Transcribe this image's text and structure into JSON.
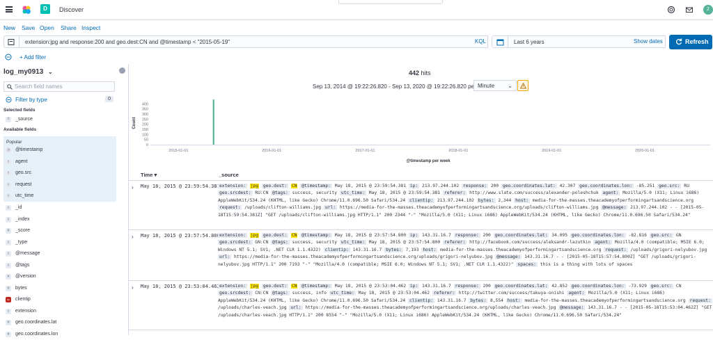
{
  "header": {
    "app_title": "Discover",
    "space_initial": "D",
    "user_initial": "2"
  },
  "menu": {
    "new": "New",
    "save": "Save",
    "open": "Open",
    "share": "Share",
    "inspect": "Inspect"
  },
  "query": {
    "text": "extension:jpg and response:200 and  geo.dest:CN and  @timestamp < \"2015-05-19\"",
    "language": "KQL"
  },
  "time": {
    "label": "Last 6 years",
    "show_dates": "Show dates",
    "refresh": "Refresh"
  },
  "filter": {
    "add": "+ Add filter"
  },
  "sidebar": {
    "index_pattern": "log_my0913",
    "search_placeholder": "Search field names",
    "filter_by_type": "Filter by type",
    "filter_count": "0",
    "selected_label": "Selected fields",
    "selected": [
      {
        "type": "?",
        "name": "_source"
      }
    ],
    "available_label": "Available fields",
    "popular_label": "Popular",
    "popular": [
      {
        "type": "◷",
        "name": "@timestamp"
      },
      {
        "type": "t",
        "name": "agent"
      },
      {
        "type": "t",
        "name": "geo.src"
      },
      {
        "type": "t",
        "name": "request"
      },
      {
        "type": "t",
        "name": "utc_time"
      }
    ],
    "fields": [
      {
        "type": "t",
        "name": "_id"
      },
      {
        "type": "t",
        "name": "_index"
      },
      {
        "type": "#",
        "name": "_score"
      },
      {
        "type": "t",
        "name": "_type"
      },
      {
        "type": "t",
        "name": "@message"
      },
      {
        "type": "t",
        "name": "@tags"
      },
      {
        "type": "#",
        "name": "@version"
      },
      {
        "type": "#",
        "name": "bytes"
      },
      {
        "type": "ip",
        "name": "clientip"
      },
      {
        "type": "t",
        "name": "extension"
      },
      {
        "type": "#",
        "name": "geo.coordinates.lat"
      },
      {
        "type": "#",
        "name": "geo.coordinates.lon"
      }
    ]
  },
  "main": {
    "hits_count": "442",
    "hits_label": "hits",
    "range_text": "Sep 13, 2014 @ 19:22:26.820 - Sep 13, 2020 @ 19:22:26.820 per",
    "interval": "Minute",
    "col_time": "Time ▾",
    "col_source": "_source"
  },
  "chart_data": {
    "type": "bar",
    "ylabel": "Count",
    "xlabel": "@timestamp per week",
    "ylim": [
      0,
      450
    ],
    "yticks": [
      "400",
      "350",
      "300",
      "250",
      "200",
      "150",
      "100",
      "50",
      "0"
    ],
    "xticks": [
      "2015-01-01",
      "2016-01-01",
      "2017-01-01",
      "2018-01-01",
      "2019-01-01",
      "2020-01-01"
    ],
    "bars": [
      {
        "x": "2015-05-18",
        "value": 442
      }
    ],
    "color": "#54b399"
  },
  "docs": [
    {
      "time": "May 18, 2015 @ 23:59:54.381",
      "source": [
        [
          "extension:",
          "jpg",
          true
        ],
        [
          "geo.dest:",
          "CN",
          true
        ],
        [
          "@timestamp:",
          "May 18, 2015 @ 23:59:54.381"
        ],
        [
          "ip:",
          "213.97.244.102"
        ],
        [
          "response:",
          "200"
        ],
        [
          "geo.coordinates.lat:",
          "42.307"
        ],
        [
          "geo.coordinates.lon:",
          "-85.251"
        ],
        [
          "geo.src:",
          "RU"
        ],
        [
          "geo.srcdest:",
          "RU:CN"
        ],
        [
          "@tags:",
          "success, security"
        ],
        [
          "utc_time:",
          "May 18, 2015 @ 23:59:54.381"
        ],
        [
          "referer:",
          "http://www.slate.com/success/alexander-poleshchuk"
        ],
        [
          "agent:",
          "Mozilla/5.0 (X11; Linux i686) AppleWebKit/534.24 (KHTML, like Gecko) Chrome/11.0.696.50 Safari/534.24"
        ],
        [
          "clientip:",
          "213.97.244.102"
        ],
        [
          "bytes:",
          "2,344"
        ],
        [
          "host:",
          "media-for-the-masses.theacademyofperformingartsandscience.org"
        ],
        [
          "request:",
          "/uploads/clifton-williams.jpg"
        ],
        [
          "url:",
          "https://media-for-the-masses.theacademyofperformingartsandscience.org/uploads/clifton-williams.jpg"
        ],
        [
          "@message:",
          "213.97.244.102 - - [2015-05-18T15:59:54.381Z] \"GET /uploads/clifton-williams.jpg HTTP/1.1\" 200 2344 \"-\" \"Mozilla/5.0 (X11; Linux i686) AppleWebKit/534.24 (KHTML, like Gecko) Chrome/11.0.696.50 Safari/534.24\""
        ]
      ]
    },
    {
      "time": "May 18, 2015 @ 23:57:54.800",
      "source": [
        [
          "extension:",
          "jpg",
          true
        ],
        [
          "geo.dest:",
          "CN",
          true
        ],
        [
          "@timestamp:",
          "May 18, 2015 @ 23:57:54.800"
        ],
        [
          "ip:",
          "143.31.16.7"
        ],
        [
          "response:",
          "200"
        ],
        [
          "geo.coordinates.lat:",
          "34.095"
        ],
        [
          "geo.coordinates.lon:",
          "-82.816"
        ],
        [
          "geo.src:",
          "GN"
        ],
        [
          "geo.srcdest:",
          "GN:CN"
        ],
        [
          "@tags:",
          "success, security"
        ],
        [
          "utc_time:",
          "May 18, 2015 @ 23:57:54.800"
        ],
        [
          "referer:",
          "http://facebook.com/success/aleksandr-lazutkin"
        ],
        [
          "agent:",
          "Mozilla/4.0 (compatible; MSIE 6.0; Windows NT 5.1; SV1; .NET CLR 1.1.4322)"
        ],
        [
          "clientip:",
          "143.31.16.7"
        ],
        [
          "bytes:",
          "7,193"
        ],
        [
          "host:",
          "media-for-the-masses.theacademyofperformingartsandscience.org"
        ],
        [
          "request:",
          "/uploads/grigori-nelyubov.jpg"
        ],
        [
          "url:",
          "https://media-for-the-masses.theacademyofperformingartsandscience.org/uploads/grigori-nelyubov.jpg"
        ],
        [
          "@message:",
          "143.31.16.7 - - [2015-05-18T15:57:54.800Z] \"GET /uploads/grigori-nelyubov.jpg HTTP/1.1\" 200 7193 \"-\" \"Mozilla/4.0 (compatible; MSIE 6.0; Windows NT 5.1; SV1; .NET CLR 1.1.4322)\""
        ],
        [
          "spaces:",
          "this is a thing with lots of spaces"
        ]
      ]
    },
    {
      "time": "May 18, 2015 @ 23:53:04.462",
      "source": [
        [
          "extension:",
          "jpg",
          true
        ],
        [
          "geo.dest:",
          "CN",
          true
        ],
        [
          "@timestamp:",
          "May 18, 2015 @ 23:53:04.462"
        ],
        [
          "ip:",
          "143.31.16.7"
        ],
        [
          "response:",
          "200"
        ],
        [
          "geo.coordinates.lat:",
          "42.852"
        ],
        [
          "geo.coordinates.lon:",
          "-73.929"
        ],
        [
          "geo.src:",
          "CN"
        ],
        [
          "geo.srcdest:",
          "CN:CN"
        ],
        [
          "@tags:",
          "success, info"
        ],
        [
          "utc_time:",
          "May 18, 2015 @ 23:53:04.462"
        ],
        [
          "referer:",
          "http://twitter.com/success/takuya-onishi"
        ],
        [
          "agent:",
          "Mozilla/5.0 (X11; Linux i686) AppleWebKit/534.24 (KHTML, like Gecko) Chrome/11.0.696.50 Safari/534.24"
        ],
        [
          "clientip:",
          "143.31.16.7"
        ],
        [
          "bytes:",
          "8,554"
        ],
        [
          "host:",
          "media-for-the-masses.theacademyofperformingartsandscience.org"
        ],
        [
          "request:",
          "/uploads/charles-veach.jpg"
        ],
        [
          "url:",
          "https://media-for-the-masses.theacademyofperformingartsandscience.org/uploads/charles-veach.jpg"
        ],
        [
          "@message:",
          "143.31.16.7 - - [2015-05-18T15:53:04.462Z] \"GET /uploads/charles-veach.jpg HTTP/1.1\" 200 8554 \"-\" \"Mozilla/5.0 (X11; Linux i686) AppleWebKit/534.24 (KHTML, like Gecko) Chrome/11.0.696.50 Safari/534.24\""
        ]
      ]
    }
  ]
}
